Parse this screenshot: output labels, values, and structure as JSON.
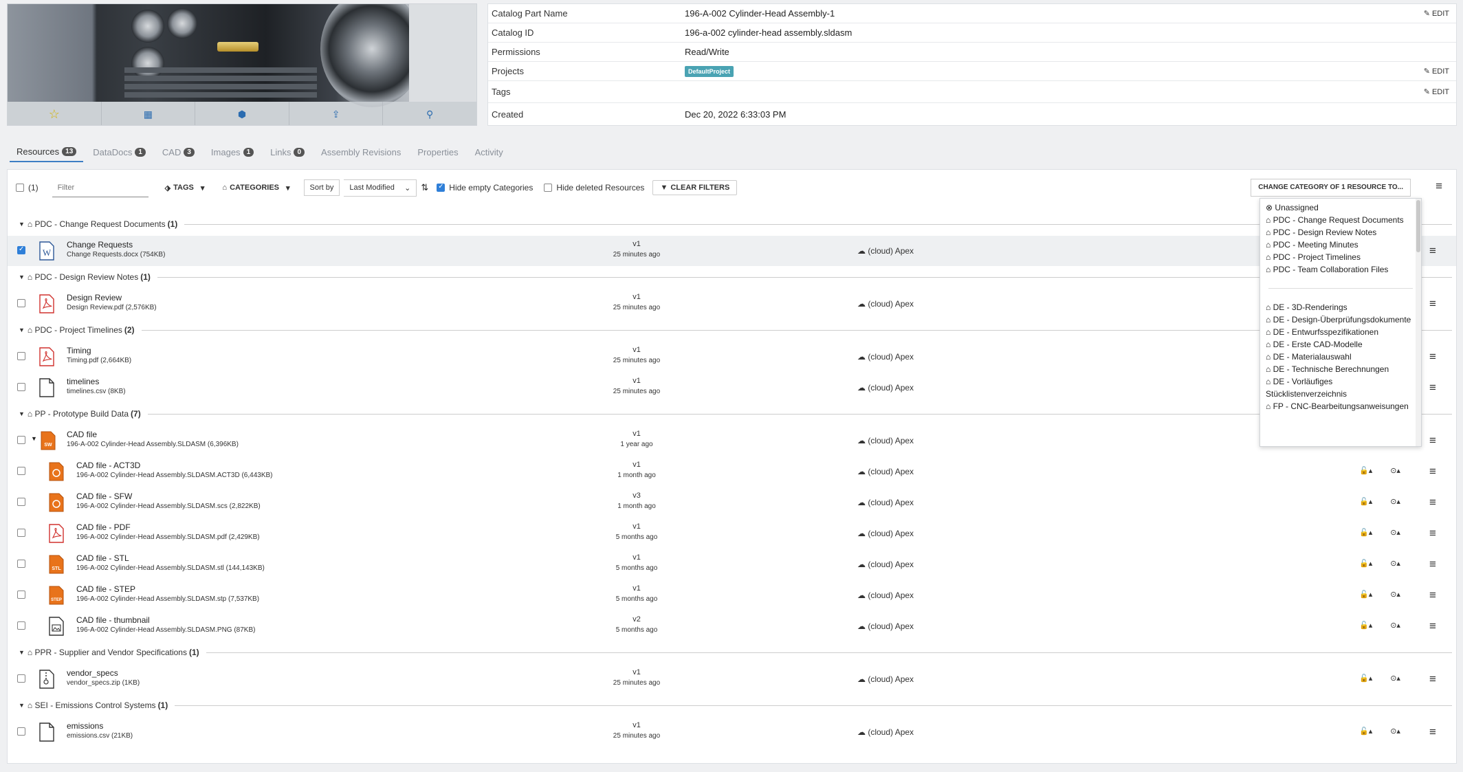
{
  "details": {
    "rows": [
      {
        "label": "Catalog Part Name",
        "value": "196-A-002 Cylinder-Head Assembly-1",
        "edit": "EDIT"
      },
      {
        "label": "Catalog ID",
        "value": "196-a-002 cylinder-head assembly.sldasm"
      },
      {
        "label": "Permissions",
        "value": "Read/Write"
      },
      {
        "label": "Projects",
        "badge": "DefaultProject",
        "edit": "EDIT"
      },
      {
        "label": "Tags",
        "value": "",
        "edit": "EDIT"
      },
      {
        "label": "Created",
        "value": "Dec 20, 2022 6:33:03 PM"
      }
    ]
  },
  "tabs": [
    {
      "label": "Resources",
      "count": "13"
    },
    {
      "label": "DataDocs",
      "count": "1"
    },
    {
      "label": "CAD",
      "count": "3"
    },
    {
      "label": "Images",
      "count": "1"
    },
    {
      "label": "Links",
      "count": "0"
    },
    {
      "label": "Assembly Revisions"
    },
    {
      "label": "Properties"
    },
    {
      "label": "Activity"
    }
  ],
  "toolbar": {
    "selected_count": "(1)",
    "filter_placeholder": "Filter",
    "tags": "TAGS",
    "categories": "CATEGORIES",
    "sort_by": "Sort by",
    "sort_value": "Last Modified",
    "hide_empty": "Hide empty Categories",
    "hide_deleted": "Hide deleted Resources",
    "clear_filters": "CLEAR FILTERS",
    "change_category": "CHANGE CATEGORY OF 1 RESOURCE TO..."
  },
  "location": "(cloud) Apex",
  "categories": [
    {
      "name": "PDC - Change Request Documents",
      "count": "(1)"
    },
    {
      "name": "PDC - Design Review Notes",
      "count": "(1)"
    },
    {
      "name": "PDC - Project Timelines",
      "count": "(2)"
    },
    {
      "name": "PP - Prototype Build Data",
      "count": "(7)"
    },
    {
      "name": "PPR - Supplier and Vendor Specifications",
      "count": "(1)"
    },
    {
      "name": "SEI - Emissions Control Systems",
      "count": "(1)"
    }
  ],
  "resources": [
    {
      "name": "Change Requests",
      "file": "Change Requests.docx (754KB)",
      "ver": "v1",
      "ago": "25 minutes ago",
      "icon": "word"
    },
    {
      "name": "Design Review",
      "file": "Design Review.pdf (2,576KB)",
      "ver": "v1",
      "ago": "25 minutes ago",
      "icon": "pdf"
    },
    {
      "name": "Timing",
      "file": "Timing.pdf (2,664KB)",
      "ver": "v1",
      "ago": "25 minutes ago",
      "icon": "pdf"
    },
    {
      "name": "timelines",
      "file": "timelines.csv (8KB)",
      "ver": "v1",
      "ago": "25 minutes ago",
      "icon": "file"
    },
    {
      "name": "CAD file",
      "file": "196-A-002 Cylinder-Head Assembly.SLDASM (6,396KB)",
      "ver": "v1",
      "ago": "1 year ago",
      "icon": "sw",
      "sw": "SW"
    },
    {
      "name": "CAD file - ACT3D",
      "file": "196-A-002 Cylinder-Head Assembly.SLDASM.ACT3D (6,443KB)",
      "ver": "v1",
      "ago": "1 month ago",
      "icon": "orange"
    },
    {
      "name": "CAD file - SFW",
      "file": "196-A-002 Cylinder-Head Assembly.SLDASM.scs (2,822KB)",
      "ver": "v3",
      "ago": "1 month ago",
      "icon": "orange"
    },
    {
      "name": "CAD file - PDF",
      "file": "196-A-002 Cylinder-Head Assembly.SLDASM.pdf (2,429KB)",
      "ver": "v1",
      "ago": "5 months ago",
      "icon": "pdf"
    },
    {
      "name": "CAD file - STL",
      "file": "196-A-002 Cylinder-Head Assembly.SLDASM.stl (144,143KB)",
      "ver": "v1",
      "ago": "5 months ago",
      "icon": "stl",
      "sw": "STL"
    },
    {
      "name": "CAD file - STEP",
      "file": "196-A-002 Cylinder-Head Assembly.SLDASM.stp (7,537KB)",
      "ver": "v1",
      "ago": "5 months ago",
      "icon": "step",
      "sw": "STEP"
    },
    {
      "name": "CAD file - thumbnail",
      "file": "196-A-002 Cylinder-Head Assembly.SLDASM.PNG (87KB)",
      "ver": "v2",
      "ago": "5 months ago",
      "icon": "image"
    },
    {
      "name": "vendor_specs",
      "file": "vendor_specs.zip (1KB)",
      "ver": "v1",
      "ago": "25 minutes ago",
      "icon": "zip"
    },
    {
      "name": "emissions",
      "file": "emissions.csv (21KB)",
      "ver": "v1",
      "ago": "25 minutes ago",
      "icon": "file"
    }
  ],
  "dropdown": {
    "group1": [
      "Unassigned",
      "PDC - Change Request Documents",
      "PDC - Design Review Notes",
      "PDC - Meeting Minutes",
      "PDC - Project Timelines",
      "PDC - Team Collaboration Files"
    ],
    "group2": [
      "DE - 3D-Renderings",
      "DE - Design-Überprüfungsdokumente",
      "DE - Entwurfsspezifikationen",
      "DE - Erste CAD-Modelle",
      "DE - Materialauswahl",
      "DE - Technische Berechnungen",
      "DE - Vorläufiges Stücklistenverzeichnis",
      "FP - CNC-Bearbeitungsanweisungen"
    ]
  }
}
